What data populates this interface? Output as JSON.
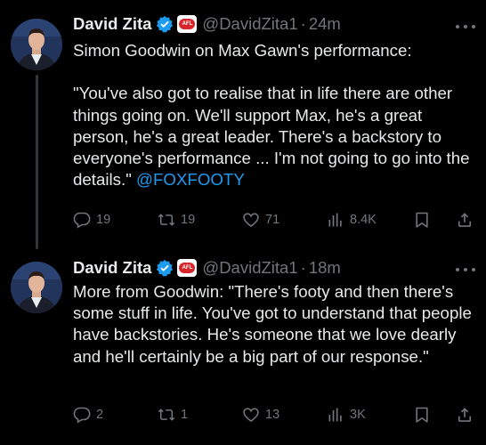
{
  "tweets": [
    {
      "author": {
        "name": "David Zita",
        "handle": "@DavidZita1",
        "verified": true,
        "affiliation_icon": "afl-badge-icon"
      },
      "separator": "·",
      "time": "24m",
      "text": {
        "line1": "Simon Goodwin on Max Gawn's performance:",
        "quote": "\"You've also got to realise that in life there are other things going on. We'll support Max, he's a great person, he's a great leader. There's a backstory to everyone's performance ... I'm not going to go into the details.\" ",
        "mention": "@FOXFOOTY"
      },
      "stats": {
        "replies": "19",
        "reposts": "19",
        "likes": "71",
        "views": "8.4K"
      }
    },
    {
      "author": {
        "name": "David Zita",
        "handle": "@DavidZita1",
        "verified": true,
        "affiliation_icon": "afl-badge-icon"
      },
      "separator": "·",
      "time": "18m",
      "text": {
        "body": "More from Goodwin: \"There's footy and then there's some stuff in life. You've got to understand that people have backstories. He's someone that we love dearly and he'll certainly be a big part of our response.\""
      },
      "stats": {
        "replies": "2",
        "reposts": "1",
        "likes": "13",
        "views": "3K"
      }
    }
  ],
  "colors": {
    "background": "#000000",
    "text": "#e7e9ea",
    "muted": "#71767b",
    "link": "#1d9bf0",
    "verified": "#1d9bf0"
  }
}
